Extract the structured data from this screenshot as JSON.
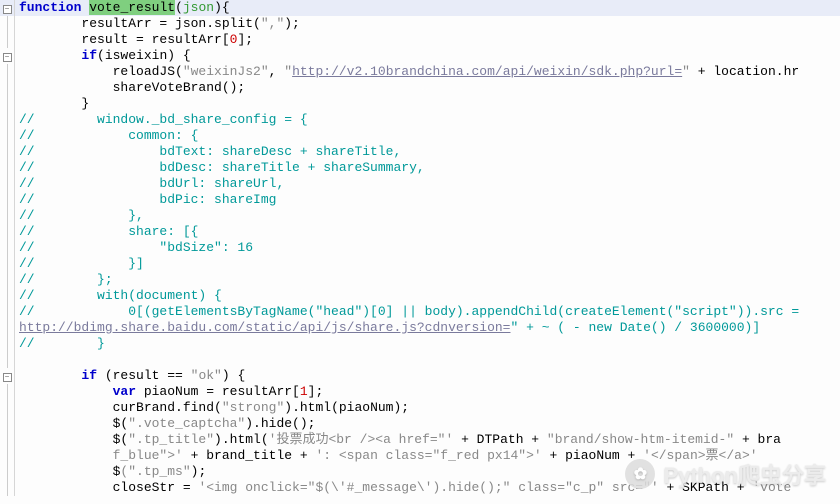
{
  "lines": [
    {
      "fold": "minus",
      "cls": "top-line",
      "html": "<span class='kw'>function</span> <span class='hl'>vote_result</span><span class='paren'>(</span><span class='var'>json</span><span class='paren'>)</span><span class='paren'>{</span>"
    },
    {
      "fold": "line",
      "html": "        resultArr = json.split(<span class='str'>\",\"</span>);"
    },
    {
      "fold": "line",
      "html": "        result = resultArr[<span class='num'>0</span>];"
    },
    {
      "fold": "minus",
      "html": "        <span class='kw'>if</span>(isweixin) {"
    },
    {
      "fold": "line",
      "html": "            reloadJS(<span class='str'>\"weixinJs2\"</span>, <span class='str'>\"</span><span class='url'>http://v2.10brandchina.com/api/weixin/sdk.php?url=</span><span class='str'>\"</span> + location.hr"
    },
    {
      "fold": "line",
      "html": "            shareVoteBrand();"
    },
    {
      "fold": "line",
      "html": "        }"
    },
    {
      "fold": "line",
      "html": "<span class='comment'>//        window._bd_share_config = {</span>"
    },
    {
      "fold": "line",
      "html": "<span class='comment'>//            common: {</span>"
    },
    {
      "fold": "line",
      "html": "<span class='comment'>//                bdText: shareDesc + shareTitle,</span>"
    },
    {
      "fold": "line",
      "html": "<span class='comment'>//                bdDesc: shareTitle + shareSummary,</span>"
    },
    {
      "fold": "line",
      "html": "<span class='comment'>//                bdUrl: shareUrl,</span>"
    },
    {
      "fold": "line",
      "html": "<span class='comment'>//                bdPic: shareImg</span>"
    },
    {
      "fold": "line",
      "html": "<span class='comment'>//            },</span>"
    },
    {
      "fold": "line",
      "html": "<span class='comment'>//            share: [{</span>"
    },
    {
      "fold": "line",
      "html": "<span class='comment'>//                \"bdSize\": 16</span>"
    },
    {
      "fold": "line",
      "html": "<span class='comment'>//            }]</span>"
    },
    {
      "fold": "line",
      "html": "<span class='comment'>//        };</span>"
    },
    {
      "fold": "line",
      "html": "<span class='comment'>//        with(document) {</span>"
    },
    {
      "fold": "line",
      "html": "<span class='comment'>//            0[(getElementsByTagName(\"head\")[0] || body).appendChild(createElement(\"script\")).src = </span>"
    },
    {
      "fold": "line",
      "html": "<span class='url'>http://bdimg.share.baidu.com/static/api/js/share.js?cdnversion=</span><span class='comment'>\" + ~ ( - new Date() / 3600000)]</span>"
    },
    {
      "fold": "line",
      "html": "<span class='comment'>//        }</span>"
    },
    {
      "fold": "line",
      "html": ""
    },
    {
      "fold": "minus",
      "html": "        <span class='kw'>if</span> (result == <span class='str'>\"ok\"</span>) {"
    },
    {
      "fold": "line",
      "html": "            <span class='kw'>var</span> piaoNum = resultArr[<span class='num'>1</span>];"
    },
    {
      "fold": "line",
      "html": "            curBrand.find(<span class='str'>\"strong\"</span>).html(piaoNum);"
    },
    {
      "fold": "line",
      "html": "            $(<span class='str'>\".vote_captcha\"</span>).hide();"
    },
    {
      "fold": "line",
      "html": "            $(<span class='str'>\".tp_title\"</span>).html(<span class='str'>'投票成功&lt;br /&gt;&lt;a href=\"'</span> + DTPath + <span class='str'>\"brand/show-htm-itemid-\"</span> + bra"
    },
    {
      "fold": "line",
      "html": "            <span class='str'>f_blue\"&gt;'</span> + brand_title + <span class='str'>': &lt;span class=\"f_red px14\"&gt;'</span> + piaoNum + <span class='str'>'&lt;/span&gt;票&lt;/a&gt;'</span>"
    },
    {
      "fold": "line",
      "html": "            $<span class='str'>(\".tp_ms\"</span>);"
    },
    {
      "fold": "line",
      "html": "            closeStr = <span class='str'>'&lt;img onclick=\"$(\\'#_message\\').hide();\" class=\"c_p\" src=\"'</span> + SKPath + <span class='str'>'vote</span>"
    }
  ],
  "watermark": {
    "text": "Python爬虫分享",
    "logo_glyph": "✿"
  }
}
